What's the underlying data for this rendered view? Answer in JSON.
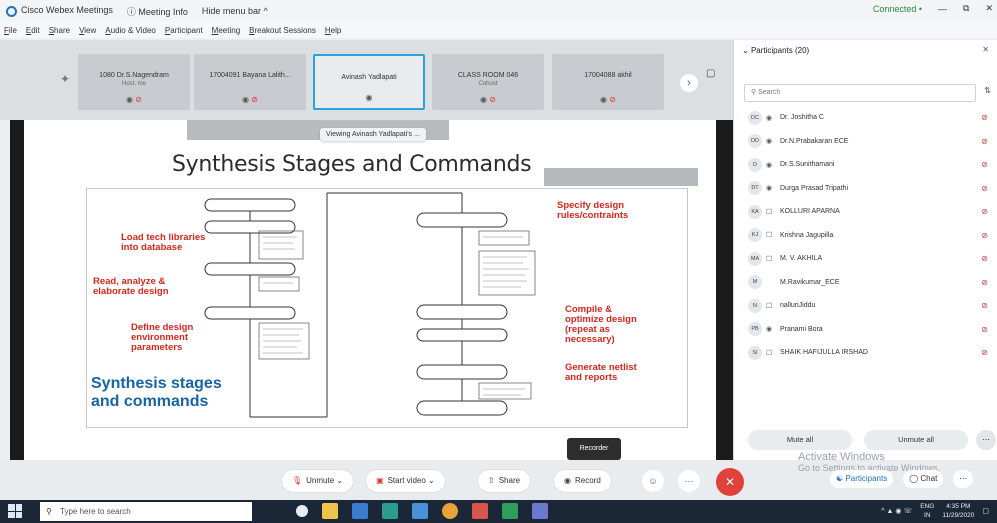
{
  "titlebar": {
    "app_title": "Cisco Webex Meetings",
    "meeting_info": "Meeting Info",
    "hide_menu": "Hide menu bar ^",
    "status": "Connected •",
    "minimize": "—",
    "restore": "⧉",
    "close": "✕"
  },
  "menubar": [
    "File",
    "Edit",
    "Share",
    "View",
    "Audio & Video",
    "Participant",
    "Meeting",
    "Breakout Sessions",
    "Help"
  ],
  "thumbnails": [
    {
      "name": "1080 Dr.S.Nagendram",
      "sub": "Host, me"
    },
    {
      "name": "17004091 Bayana Lalith...",
      "sub": ""
    },
    {
      "name": "Avinash Yadlapati",
      "sub": ""
    },
    {
      "name": "CLASS ROOM 046",
      "sub": "Cohost"
    },
    {
      "name": "17004088 akhil",
      "sub": ""
    }
  ],
  "stage": {
    "viewing_text": "Viewing Avinash Yadlapati's ...",
    "recorder_label": "Recorder"
  },
  "slide": {
    "title": "Synthesis Stages and Commands",
    "left_labels": [
      "Load tech libraries\ninto database",
      "Read, analyze &\nelaborate design",
      "Define design\nenvironment\nparameters"
    ],
    "right_labels": [
      "Specify design\nrules/contraints",
      "Compile &\noptimize design\n(repeat as\nnecessary)",
      "Generate netlist\nand reports"
    ],
    "caption": "Synthesis stages\nand commands"
  },
  "participants_panel": {
    "title": "Participants (20)",
    "search_placeholder": "Search",
    "people": [
      {
        "initials": "DC",
        "name": "Dr. Joshitha C",
        "muted": true
      },
      {
        "initials": "DD",
        "name": "Dr.N.Prabakaran ECE",
        "muted": true
      },
      {
        "initials": "D",
        "name": "Dr.S.Sunithamani",
        "muted": true
      },
      {
        "initials": "DT",
        "name": "Durga Prasad Tripathi",
        "muted": true
      },
      {
        "initials": "KA",
        "name": "KOLLURI APARNA",
        "muted": true
      },
      {
        "initials": "KJ",
        "name": "Krishna Jagupilla",
        "muted": true
      },
      {
        "initials": "MA",
        "name": "M. V. AKHILA",
        "muted": true
      },
      {
        "initials": "M",
        "name": "M.Ravikumar_ECE",
        "muted": true
      },
      {
        "initials": "N",
        "name": "nalluriJiddu",
        "muted": true
      },
      {
        "initials": "PB",
        "name": "Pranami Bora",
        "muted": true
      },
      {
        "initials": "SI",
        "name": "SHAIK HAFIJULLA IRSHAD",
        "muted": true
      }
    ],
    "mute_all": "Mute all",
    "unmute_all": "Unmute all"
  },
  "controls": {
    "unmute": "Unmute",
    "start_video": "Start video",
    "share": "Share",
    "record": "Record",
    "participants_tab": "Participants",
    "chat_tab": "Chat"
  },
  "watermark": {
    "line1": "Activate Windows",
    "line2": "Go to Settings to activate Windows."
  },
  "taskbar": {
    "search_placeholder": "Type here to search",
    "lang": "ENG\nIN",
    "time": "4:35 PM",
    "date": "11/29/2020"
  },
  "colors": {
    "accent_blue": "#29a3e0",
    "end_red": "#e0413a",
    "slide_red": "#d8261d",
    "slide_blue": "#1565a8"
  }
}
